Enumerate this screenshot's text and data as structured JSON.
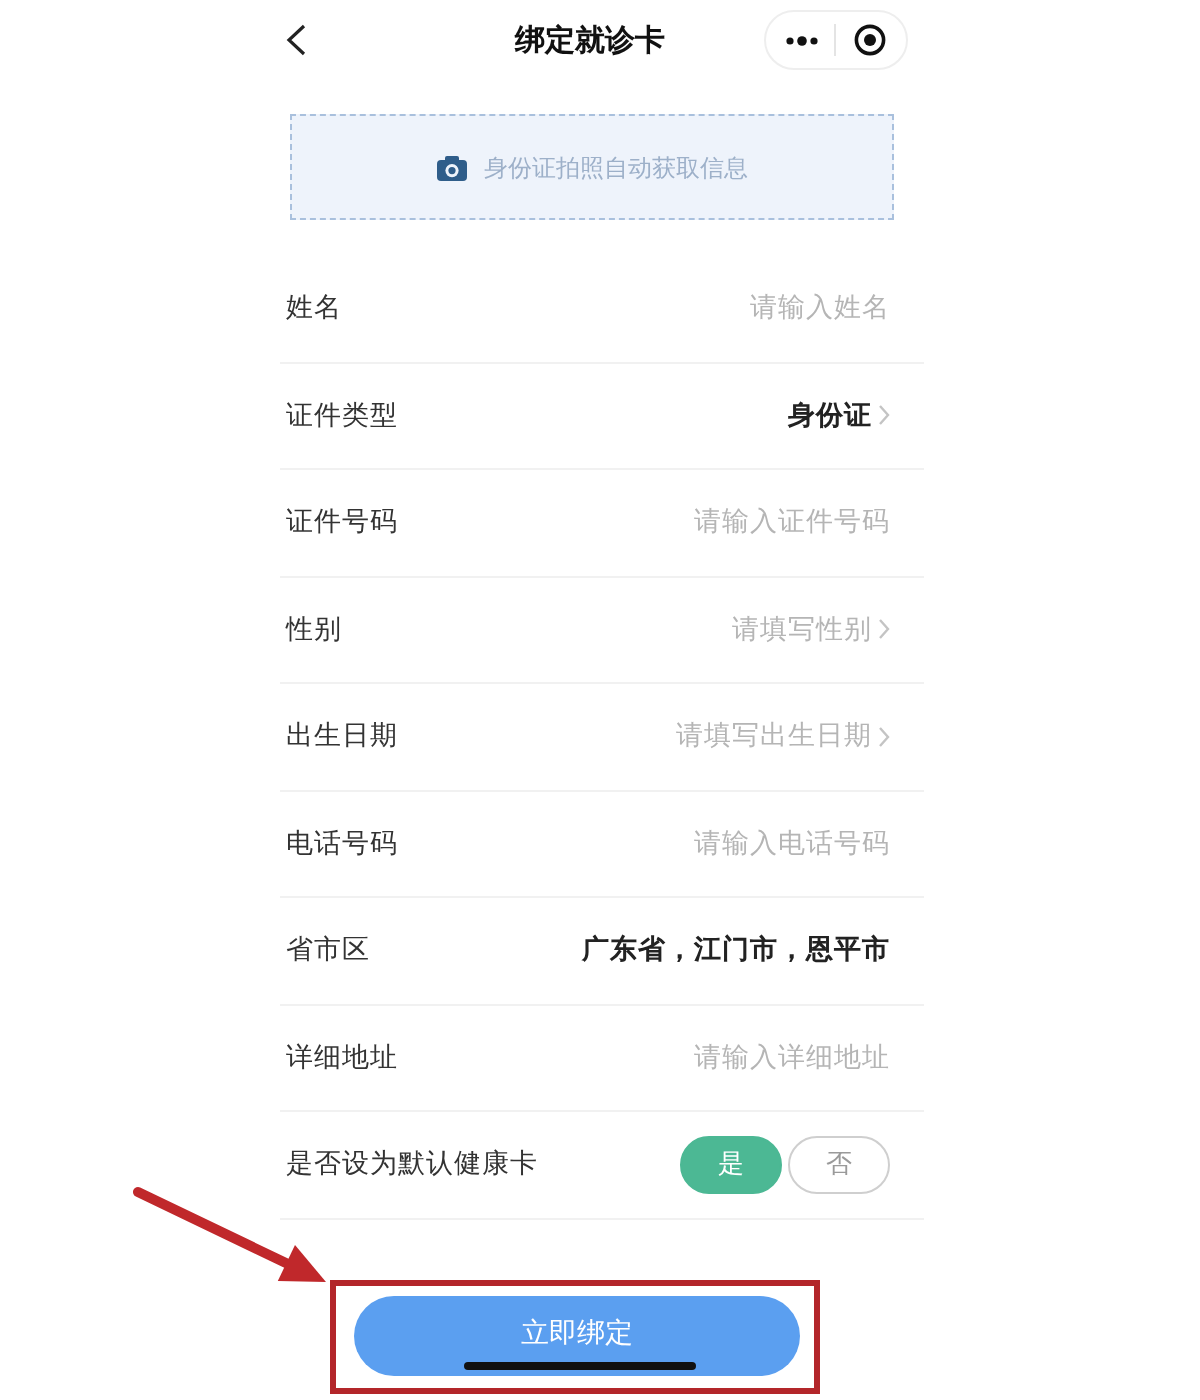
{
  "header": {
    "title": "绑定就诊卡"
  },
  "id_scan": {
    "label": "身份证拍照自动获取信息"
  },
  "fields": [
    {
      "kind": "input",
      "label": "姓名",
      "placeholder": "请输入姓名"
    },
    {
      "kind": "picker",
      "label": "证件类型",
      "value": "身份证"
    },
    {
      "kind": "input",
      "label": "证件号码",
      "placeholder": "请输入证件号码"
    },
    {
      "kind": "picker",
      "label": "性别",
      "placeholder": "请填写性别"
    },
    {
      "kind": "picker",
      "label": "出生日期",
      "placeholder": "请填写出生日期"
    },
    {
      "kind": "input",
      "label": "电话号码",
      "placeholder": "请输入电话号码"
    },
    {
      "kind": "text",
      "label": "省市区",
      "value": "广东省，江门市，恩平市"
    },
    {
      "kind": "input",
      "label": "详细地址",
      "placeholder": "请输入详细地址"
    },
    {
      "kind": "choice",
      "label": "是否设为默认健康卡",
      "options": [
        {
          "label": "是",
          "selected": true
        },
        {
          "label": "否",
          "selected": false
        }
      ]
    }
  ],
  "submit": {
    "label": "立即绑定"
  }
}
